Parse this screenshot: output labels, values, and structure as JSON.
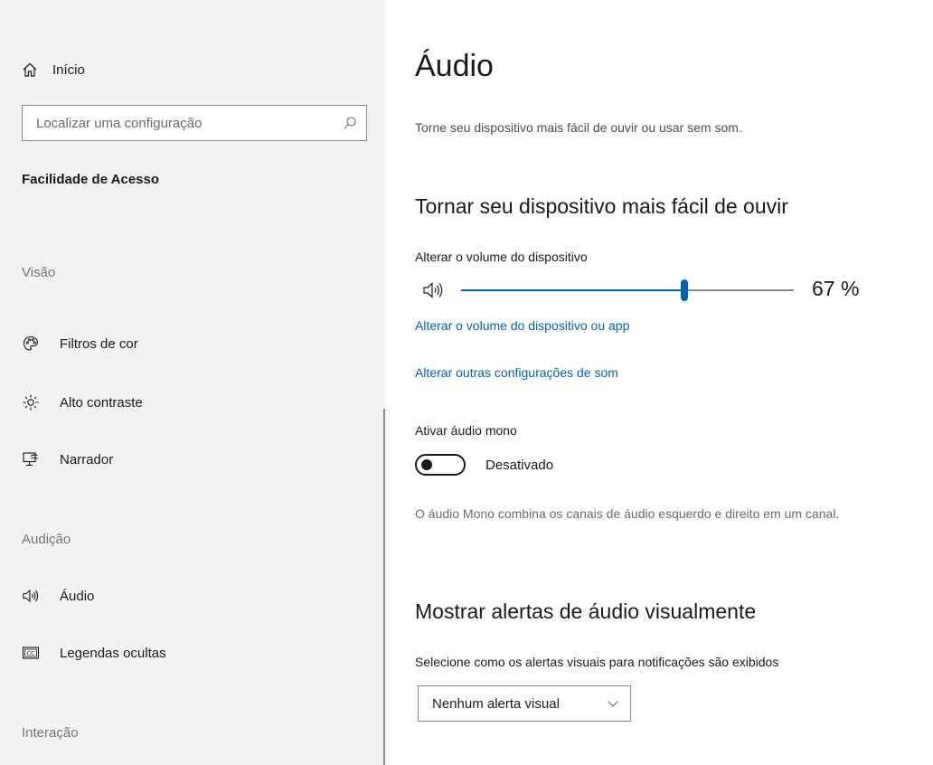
{
  "sidebar": {
    "home_label": "Início",
    "search_placeholder": "Localizar uma configuração",
    "section_title": "Facilidade de Acesso",
    "groups": {
      "vision": "Visão",
      "hearing": "Audição",
      "interaction": "Interação"
    },
    "items": [
      {
        "label": "Filtros de cor",
        "icon": "color-filter-icon"
      },
      {
        "label": "Alto contraste",
        "icon": "brightness-icon"
      },
      {
        "label": "Narrador",
        "icon": "narrator-icon"
      },
      {
        "label": "Áudio",
        "icon": "speaker-icon"
      },
      {
        "label": "Legendas ocultas",
        "icon": "closed-captions-icon"
      }
    ]
  },
  "main": {
    "title": "Áudio",
    "description": "Torne seu dispositivo mais fácil de ouvir ou usar sem som.",
    "hearing_section": {
      "heading": "Tornar seu dispositivo mais fácil de ouvir",
      "volume_label": "Alterar o volume do dispositivo",
      "volume_percent": 67,
      "volume_display": "67 %",
      "link_app_volume": "Alterar o volume do dispositivo ou app",
      "link_sound_settings": "Alterar outras configurações de som",
      "mono_label": "Ativar áudio mono",
      "mono_state": "Desativado",
      "mono_on": false,
      "mono_note": "O áudio Mono combina os canais de áudio esquerdo e direito em um canal."
    },
    "alerts_section": {
      "heading": "Mostrar alertas de áudio visualmente",
      "select_label": "Selecione como os alertas visuais para notificações são exibidos",
      "selected_option": "Nenhum alerta visual"
    }
  },
  "colors": {
    "accent": "#0063b1",
    "sidebar_bg": "#f2f2f2",
    "text": "#1a1a1a",
    "muted": "#767676"
  }
}
